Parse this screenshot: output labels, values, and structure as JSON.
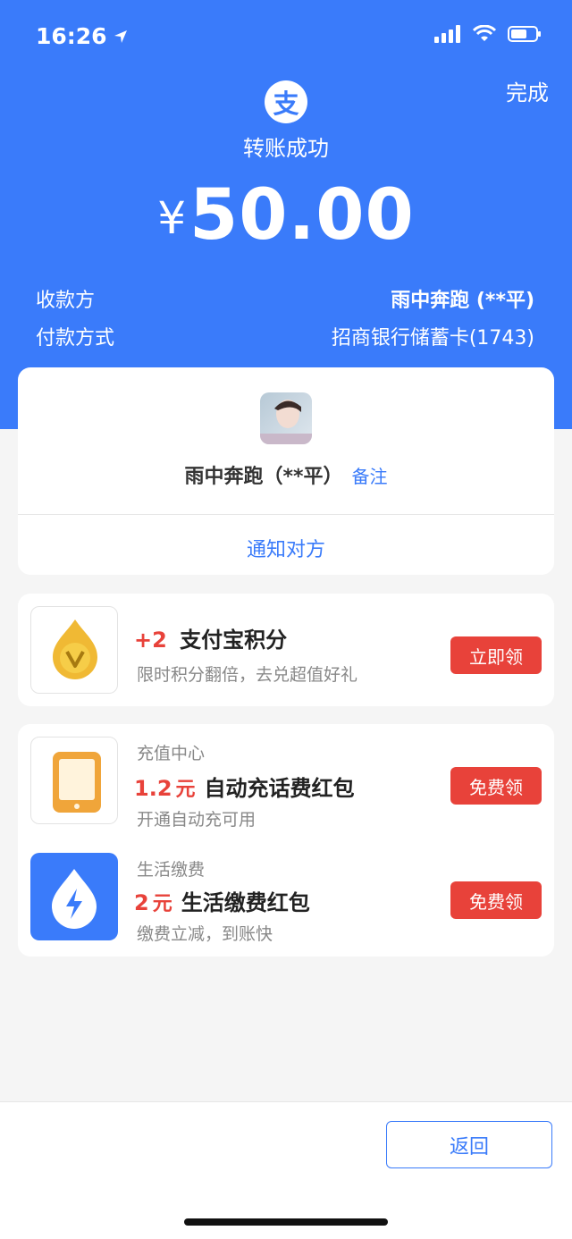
{
  "status_bar": {
    "time": "16:26"
  },
  "header": {
    "done_label": "完成",
    "logo_char": "支",
    "status_text": "转账成功",
    "currency": "¥",
    "amount": "50.00"
  },
  "details": {
    "payee_label": "收款方",
    "payee_value": "雨中奔跑 (**平)",
    "method_label": "付款方式",
    "method_value": "招商银行储蓄卡(1743)"
  },
  "payee_card": {
    "name": "雨中奔跑（**平）",
    "remark": "备注",
    "notify": "通知对方"
  },
  "points": {
    "amount": "+2",
    "title": "支付宝积分",
    "desc": "限时积分翻倍，去兑超值好礼",
    "button": "立即领"
  },
  "promos": [
    {
      "category": "充值中心",
      "amount": "1.2",
      "unit": "元",
      "title": "自动充话费红包",
      "desc": "开通自动充可用",
      "button": "免费领"
    },
    {
      "category": "生活缴费",
      "amount": "2",
      "unit": "元",
      "title": "生活缴费红包",
      "desc": "缴费立减，到账快",
      "button": "免费领"
    }
  ],
  "footer": {
    "back_label": "返回"
  },
  "colors": {
    "brand_blue": "#3a7bfa",
    "action_red": "#e8423a"
  }
}
